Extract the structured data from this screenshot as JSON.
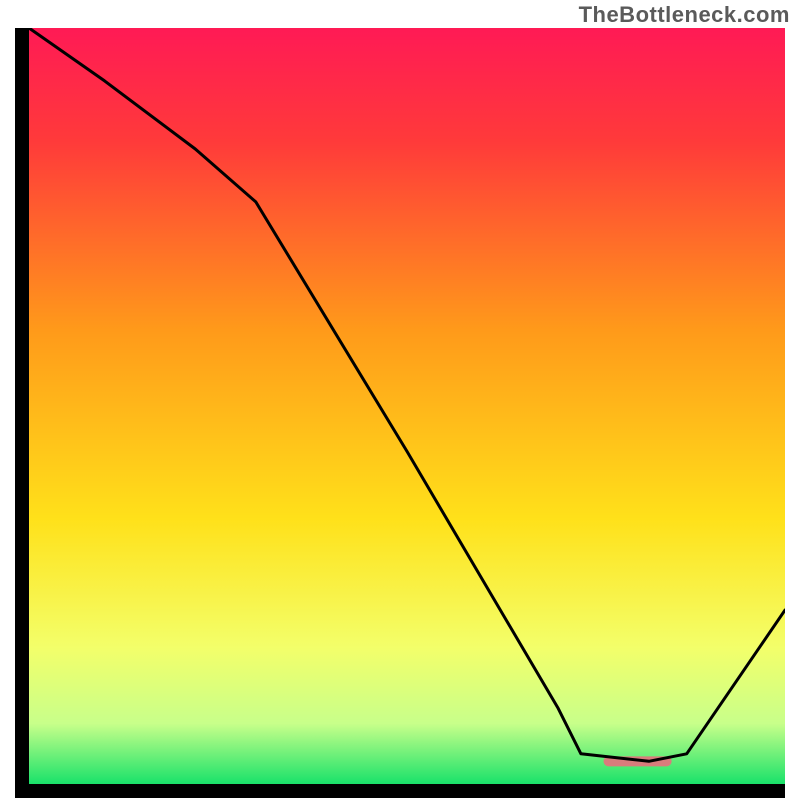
{
  "watermark": "TheBottleneck.com",
  "chart_data": {
    "type": "line",
    "title": "",
    "xlabel": "",
    "ylabel": "",
    "xlim": [
      0,
      100
    ],
    "ylim": [
      0,
      100
    ],
    "grid": false,
    "legend": false,
    "gradient_stops": [
      {
        "offset": 0.0,
        "color": "#ff1a55"
      },
      {
        "offset": 0.15,
        "color": "#ff3a3a"
      },
      {
        "offset": 0.4,
        "color": "#ff9a1a"
      },
      {
        "offset": 0.65,
        "color": "#ffe11a"
      },
      {
        "offset": 0.82,
        "color": "#f3ff6a"
      },
      {
        "offset": 0.92,
        "color": "#c8ff8a"
      },
      {
        "offset": 1.0,
        "color": "#19e26a"
      }
    ],
    "series": [
      {
        "name": "curve",
        "x": [
          0,
          10,
          22,
          30,
          50,
          70,
          73,
          82,
          87,
          100
        ],
        "y": [
          100,
          93,
          84,
          77,
          44,
          10,
          4,
          3,
          4,
          23
        ]
      }
    ],
    "marker": {
      "x_start": 76,
      "x_end": 85,
      "y": 3,
      "color": "#d97c7c"
    }
  }
}
